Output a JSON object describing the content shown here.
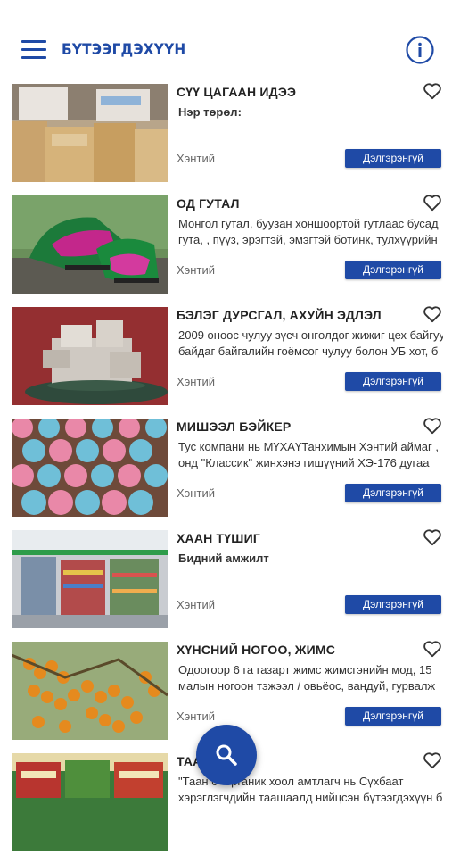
{
  "header": {
    "title": "БҮТЭЭГДЭХҮҮН",
    "menu_icon": "hamburger-menu-icon",
    "info_icon": "info-icon"
  },
  "accent_color": "#1f4aa6",
  "items": [
    {
      "title": "СҮҮ ЦАГААН ИДЭЭ",
      "desc_line1": "Нэр төрөл:",
      "desc_line2": "",
      "location": "Хэнтий",
      "button": "Дэлгэрэнгүй"
    },
    {
      "title": "ОД ГУТАЛ",
      "desc_line1": "Монгол гутал, буузан хоншоортой гутлаас бусад",
      "desc_line2": "гута, , пүүз, эрэгтэй, эмэгтэй ботинк, тулхүүрийн",
      "location": "Хэнтий",
      "button": "Дэлгэрэнгүй"
    },
    {
      "title": "БЭЛЭГ ДУРСГАЛ, АХУЙН ЭДЛЭЛ",
      "desc_line1": "2009 оноос чулуу зүсч өнгөлдөг жижиг цех байгуулсан",
      "desc_line2": "байдаг байгалийн гоёмсог чулуу болон УБ хот, б",
      "location": "Хэнтий",
      "button": "Дэлгэрэнгүй"
    },
    {
      "title": "МИШЭЭЛ БЭЙКЕР",
      "desc_line1": "Тус компани нь МҮХАҮТанхимын Хэнтий аймаг ,",
      "desc_line2": "онд \"Классик\" жинхэнэ гишүүний ХЭ-176 дугаа",
      "location": "Хэнтий",
      "button": "Дэлгэрэнгүй"
    },
    {
      "title": "ХААН ТҮШИГ",
      "desc_line1": "Бидний амжилт",
      "desc_line2": "",
      "location": "Хэнтий",
      "button": "Дэлгэрэнгүй"
    },
    {
      "title": "ХҮНСНИЙ НОГОО, ЖИМС",
      "desc_line1": "Одоогоор 6 га газарт жимс жимсгэнийн мод, 15",
      "desc_line2": "малын ногоон тэжээл / овьёос, вандуй, гурвалж",
      "location": "Хэнтий",
      "button": "Дэлгэрэнгүй"
    },
    {
      "title": "ТААН",
      "desc_line1": "\"Таан   с\" органик хоол амтлагч нь Сүхбаат",
      "desc_line2": "хэрэглэгчдийн таашаалд нийцсэн бүтээгдэхүүн б",
      "location": "",
      "button": ""
    }
  ],
  "fab": {
    "icon": "search-icon"
  }
}
